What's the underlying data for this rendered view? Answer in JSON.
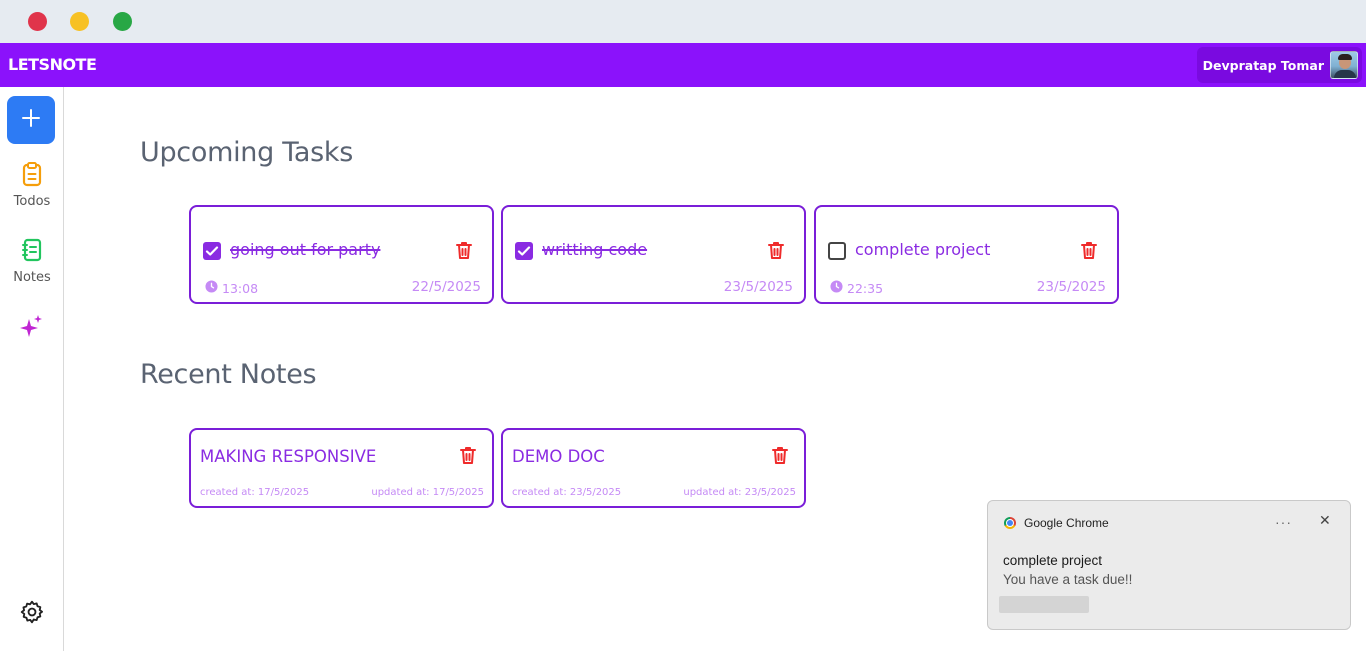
{
  "window": {
    "controls": [
      "close",
      "minimize",
      "maximize"
    ]
  },
  "header": {
    "brand": "LETSNOTE",
    "user_name": "Devpratap Tomar",
    "accent_color": "#8b12fb"
  },
  "sidebar": {
    "add_icon": "plus-icon",
    "items": [
      {
        "label": "Todos",
        "icon": "clipboard-icon",
        "color": "#f59e0b"
      },
      {
        "label": "Notes",
        "icon": "notebook-icon",
        "color": "#22c55e"
      },
      {
        "label": "",
        "icon": "sparkles-icon",
        "color": "#c026d3"
      }
    ],
    "settings_icon": "gear-icon"
  },
  "sections": {
    "upcoming_title": "Upcoming Tasks",
    "recent_title": "Recent Notes"
  },
  "tasks": [
    {
      "text": "going out for party",
      "done": true,
      "time": "13:08",
      "date": "22/5/2025"
    },
    {
      "text": "writting code",
      "done": true,
      "time": "",
      "date": "23/5/2025"
    },
    {
      "text": "complete project",
      "done": false,
      "time": "22:35",
      "date": "23/5/2025"
    }
  ],
  "notes": [
    {
      "title": "MAKING RESPONSIVE",
      "created": "created at: 17/5/2025",
      "updated": "updated at: 17/5/2025"
    },
    {
      "title": "DEMO DOC",
      "created": "created at: 23/5/2025",
      "updated": "updated at: 23/5/2025"
    }
  ],
  "notification": {
    "app": "Google Chrome",
    "more": "···",
    "close": "✕",
    "title": "complete project",
    "body": "You have a task due!!"
  }
}
